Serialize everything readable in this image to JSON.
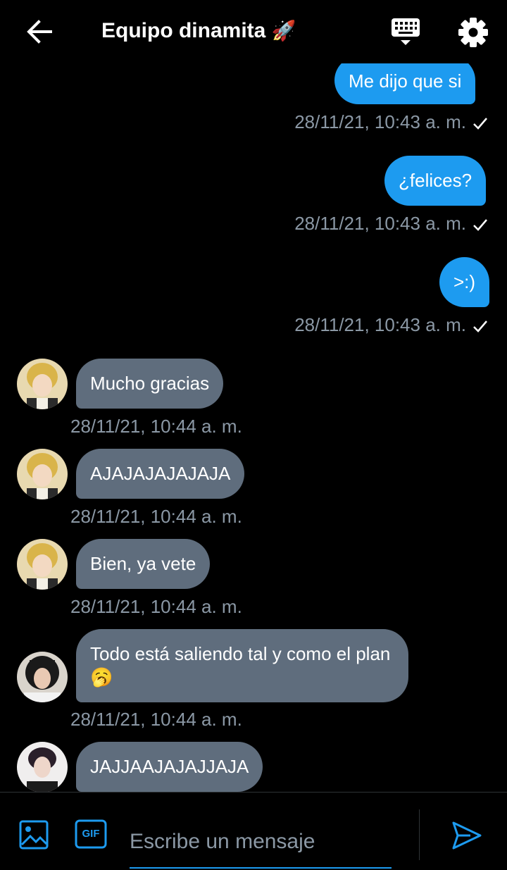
{
  "header": {
    "title": "Equipo dinamita",
    "title_emoji": "🚀",
    "back_icon": "arrow-left-icon",
    "keyboard_icon": "keyboard-icon",
    "settings_icon": "gear-icon"
  },
  "messages": [
    {
      "direction": "out",
      "text": "Me dijo que si",
      "timestamp": "28/11/21, 10:43 a. m."
    },
    {
      "direction": "out",
      "text": "¿felices?",
      "timestamp": "28/11/21, 10:43 a. m."
    },
    {
      "direction": "out",
      "text": ">:)",
      "timestamp": "28/11/21, 10:43 a. m."
    },
    {
      "direction": "in",
      "text": "Mucho gracias",
      "timestamp": "28/11/21, 10:44 a. m."
    },
    {
      "direction": "in",
      "text": "AJAJAJAJAJAJA",
      "timestamp": "28/11/21, 10:44 a. m."
    },
    {
      "direction": "in",
      "text": "Bien, ya vete",
      "timestamp": "28/11/21, 10:44 a. m."
    },
    {
      "direction": "in",
      "text": "Todo está saliendo tal y como el plan 🥱",
      "timestamp": "28/11/21, 10:44 a. m."
    },
    {
      "direction": "in",
      "text": "JAJJAAJAJAJJAJA",
      "timestamp": ""
    }
  ],
  "composer": {
    "placeholder": "Escribe un mensaje",
    "image_icon": "image-icon",
    "gif_label": "GIF",
    "send_icon": "send-icon"
  },
  "colors": {
    "background": "#000000",
    "outgoing_bubble": "#1d9bf0",
    "incoming_bubble": "#5f6d7d",
    "timestamp": "#8b98a5",
    "accent": "#1d9bf0"
  }
}
